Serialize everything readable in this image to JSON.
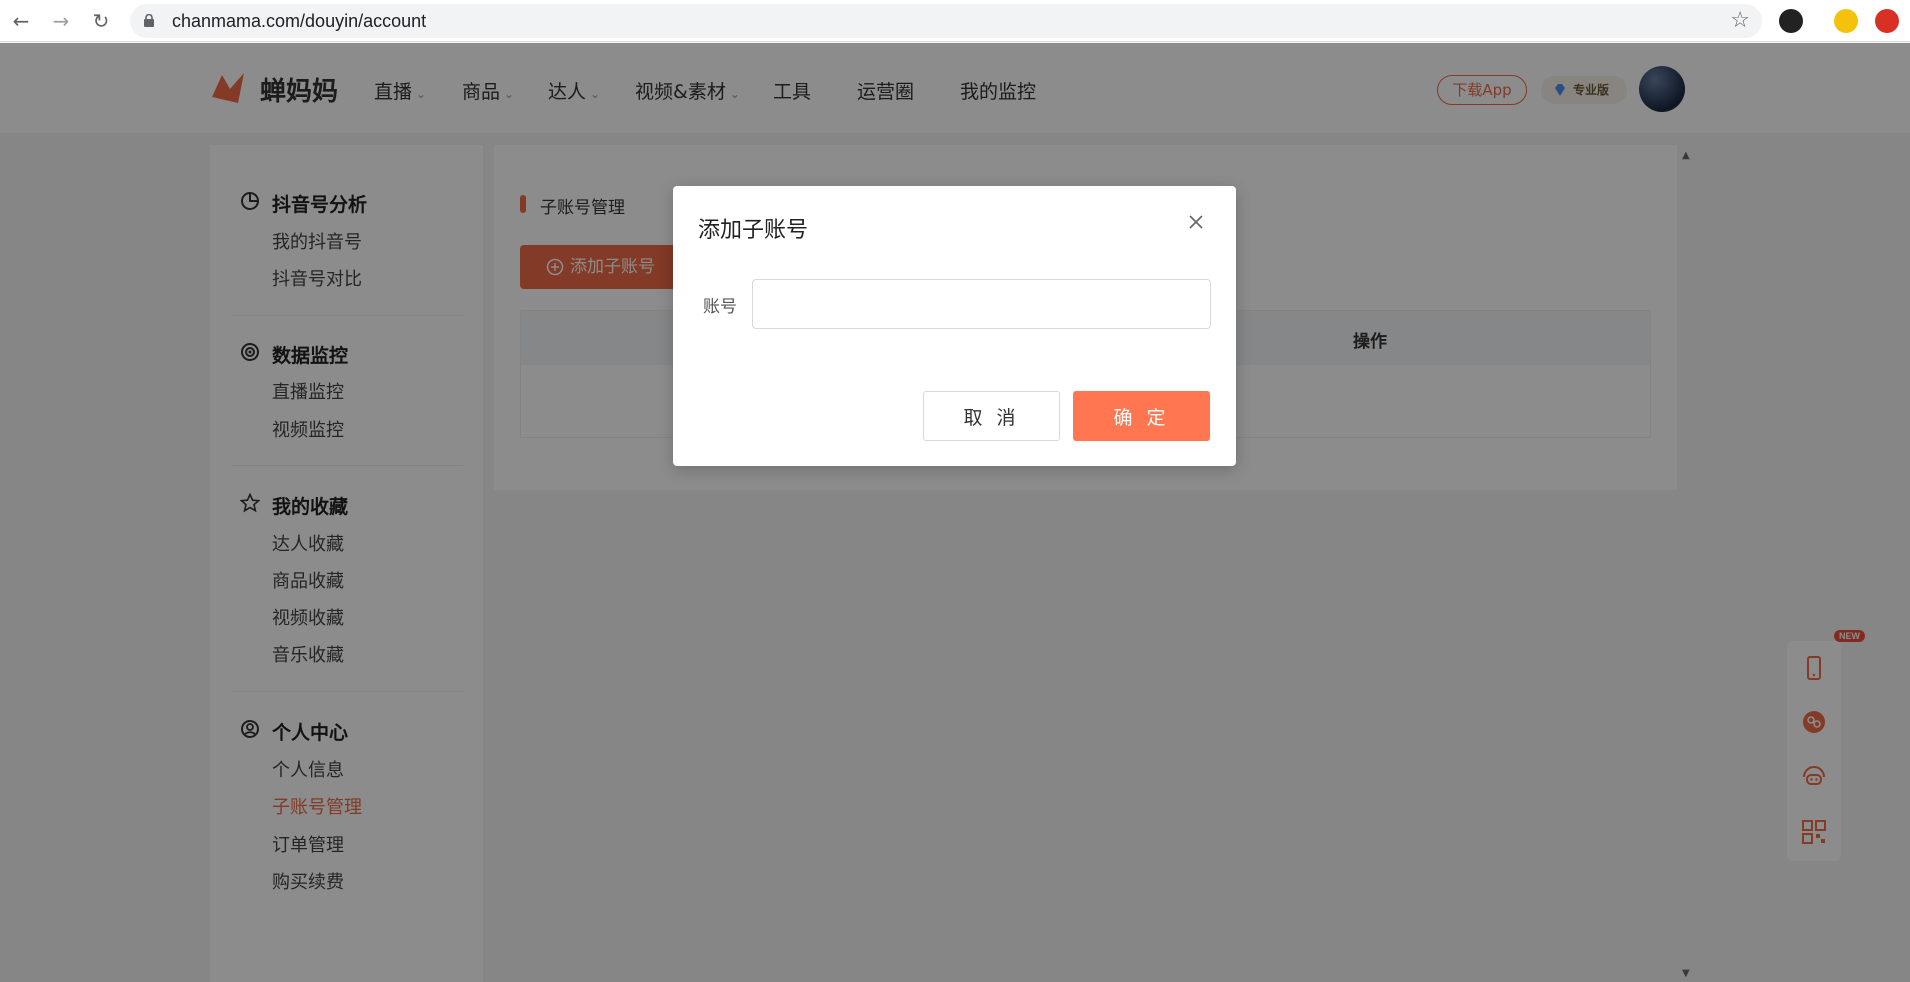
{
  "browser": {
    "url": "chanmama.com/douyin/account",
    "icons": [
      "back-icon",
      "forward-icon",
      "reload-icon",
      "lock-icon",
      "bookmark-star-icon"
    ]
  },
  "header": {
    "logo_text": "蝉妈妈",
    "nav": [
      {
        "label": "直播",
        "has_dropdown": true
      },
      {
        "label": "商品",
        "has_dropdown": true
      },
      {
        "label": "达人",
        "has_dropdown": true
      },
      {
        "label": "视频&素材",
        "has_dropdown": true
      },
      {
        "label": "工具",
        "has_dropdown": false
      },
      {
        "label": "运营圈",
        "has_dropdown": false
      },
      {
        "label": "我的监控",
        "has_dropdown": false
      }
    ],
    "download_app": "下载App",
    "pro_badge": "专业版"
  },
  "sidebar": {
    "groups": [
      {
        "title": "抖音号分析",
        "icon": "pie-chart-icon",
        "items": [
          "我的抖音号",
          "抖音号对比"
        ]
      },
      {
        "title": "数据监控",
        "icon": "radar-icon",
        "items": [
          "直播监控",
          "视频监控"
        ]
      },
      {
        "title": "我的收藏",
        "icon": "star-icon",
        "items": [
          "达人收藏",
          "商品收藏",
          "视频收藏",
          "音乐收藏"
        ]
      },
      {
        "title": "个人中心",
        "icon": "user-circle-icon",
        "items": [
          "个人信息",
          "子账号管理",
          "订单管理",
          "购买续费"
        ]
      }
    ],
    "active_item": "子账号管理"
  },
  "main": {
    "section_title": "子账号管理",
    "add_button": "添加子账号",
    "table": {
      "op_header": "操作"
    }
  },
  "float_bar": {
    "new_tag": "NEW",
    "icons": [
      "phone-icon",
      "link-settings-icon",
      "chat-bot-icon",
      "qrcode-icon"
    ]
  },
  "modal": {
    "title": "添加子账号",
    "field_label": "账号",
    "field_value": "",
    "field_placeholder": "",
    "cancel": "取 消",
    "ok": "确 定"
  },
  "colors": {
    "accent": "#ef6a45",
    "ok_button": "#ff7650",
    "overlay": "rgba(0,0,0,0.45)"
  }
}
